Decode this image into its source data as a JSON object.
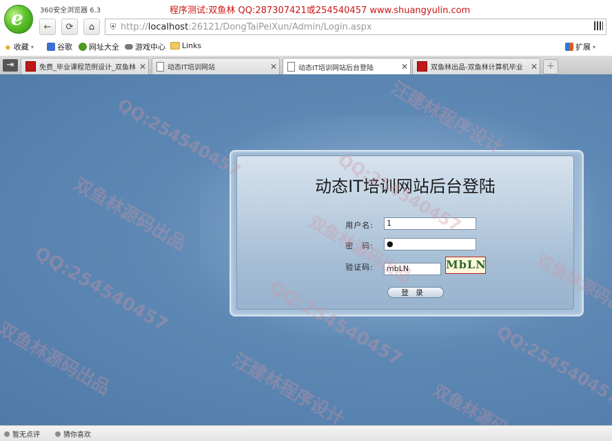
{
  "browser": {
    "app_name": "360安全浏览器 6.3",
    "window_title": "程序测试:双鱼林 QQ:287307421或254540457 www.shuangyulin.com",
    "url_prefix": "http://",
    "url_host": "localhost",
    "url_rest": ":26121/DongTaiPeiXun/Admin/Login.aspx"
  },
  "bookmarks": {
    "items": [
      {
        "label": "收藏",
        "icon": "star-icon"
      },
      {
        "label": "谷歌",
        "icon": "google-icon"
      },
      {
        "label": "网址大全",
        "icon": "globe-icon"
      },
      {
        "label": "游戏中心",
        "icon": "gamepad-icon"
      },
      {
        "label": "Links",
        "icon": "folder-icon"
      }
    ],
    "extensions_label": "扩展"
  },
  "tabs": [
    {
      "label": "免费_毕业课程范例设计_双鱼林",
      "icon": "red-favicon",
      "active": false
    },
    {
      "label": "动态IT培训网站",
      "icon": "page-icon",
      "active": false
    },
    {
      "label": "动态IT培训网站后台登陆",
      "icon": "page-icon",
      "active": true
    },
    {
      "label": "双鱼林出品-双鱼林计算机毕业",
      "icon": "red-favicon",
      "active": false
    }
  ],
  "login": {
    "title": "动态IT培训网站后台登陆",
    "username_label": "用户名:",
    "username_value": "1",
    "password_label": "密　码:",
    "password_value": "●",
    "captcha_label": "验证码:",
    "captcha_value": "mbLN",
    "captcha_image_text": "MbLN",
    "submit_label": "登录"
  },
  "statusbar": {
    "left_label": "暂无点评",
    "right_label": "猜你喜欢"
  },
  "watermarks": {
    "qq": "QQ:254540457",
    "author1": "双鱼林源码出品",
    "author2": "汪建林程序设计"
  },
  "colors": {
    "title_red": "#cc1515",
    "page_blue": "#5e88b4",
    "watermark": "#d296a0"
  }
}
